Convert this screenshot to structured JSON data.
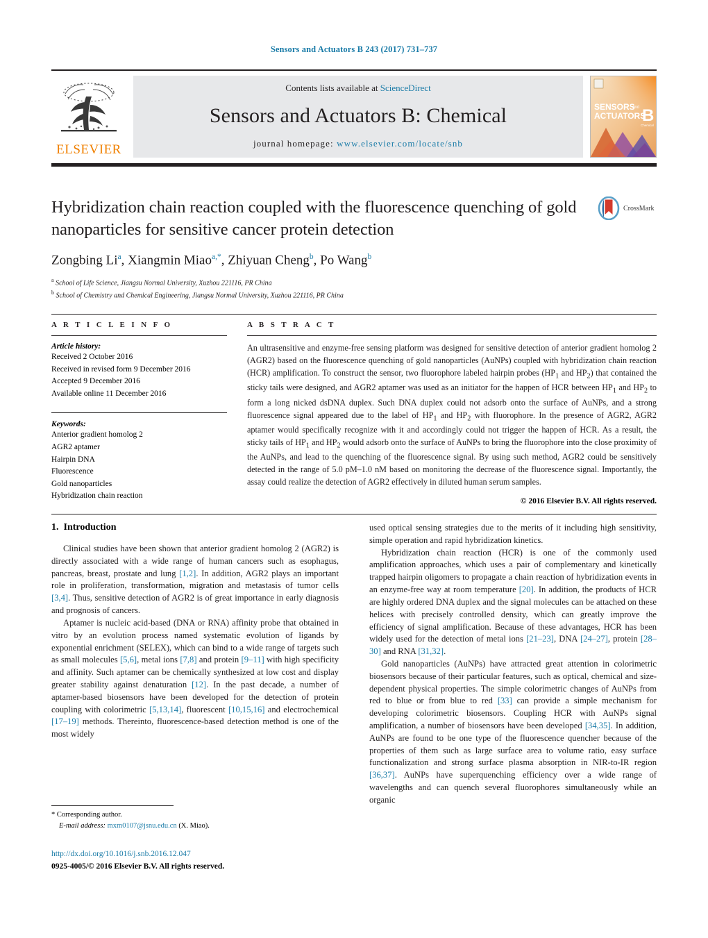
{
  "running_head": "Sensors and Actuators B 243 (2017) 731–737",
  "masthead": {
    "contents_prefix": "Contents lists available at ",
    "sciencedirect": "ScienceDirect",
    "journal_title": "Sensors and Actuators B: Chemical",
    "homepage_prefix": "journal homepage: ",
    "homepage_url": "www.elsevier.com/locate/snb",
    "publisher": "ELSEVIER",
    "cover_line1": "SENSORS",
    "cover_and": "and",
    "cover_line2": "ACTUATORS",
    "cover_letter": "B",
    "cover_sub": "Chemical",
    "accent_orange": "#f08000",
    "band_gray": "#e7e8ea",
    "link_blue": "#1b7ca8"
  },
  "title_block": {
    "title": "Hybridization chain reaction coupled with the fluorescence quenching of gold nanoparticles for sensitive cancer protein detection",
    "crossmark_label": "CrossMark",
    "authors_html": "Zongbing Li<sup>a</sup>, Xiangmin Miao<sup>a,*</sup>, Zhiyuan Cheng<sup>b</sup>, Po Wang<sup>b</sup>",
    "affiliations": [
      {
        "marker": "a",
        "text": "School of Life Science, Jiangsu Normal University, Xuzhou 221116, PR China"
      },
      {
        "marker": "b",
        "text": "School of Chemistry and Chemical Engineering, Jiangsu Normal University, Xuzhou 221116, PR China"
      }
    ]
  },
  "article_info": {
    "heading": "A R T I C L E   I N F O",
    "history_label": "Article history:",
    "history": [
      "Received 2 October 2016",
      "Received in revised form 9 December 2016",
      "Accepted 9 December 2016",
      "Available online 11 December 2016"
    ],
    "keywords_label": "Keywords:",
    "keywords": [
      "Anterior gradient homolog 2",
      "AGR2 aptamer",
      "Hairpin DNA",
      "Fluorescence",
      "Gold nanoparticles",
      "Hybridization chain reaction"
    ]
  },
  "abstract": {
    "heading": "A B S T R A C T",
    "text_html": "An ultrasensitive and enzyme-free sensing platform was designed for sensitive detection of anterior gradient homolog 2 (AGR2) based on the fluorescence quenching of gold nanoparticles (AuNPs) coupled with hybridization chain reaction (HCR) amplification. To construct the sensor, two fluorophore labeled hairpin probes (HP<sub>1</sub> and HP<sub>2</sub>) that contained the sticky tails were designed, and AGR2 aptamer was used as an initiator for the happen of HCR between HP<sub>1</sub> and HP<sub>2</sub> to form a long nicked dsDNA duplex. Such DNA duplex could not adsorb onto the surface of AuNPs, and a strong fluorescence signal appeared due to the label of HP<sub>1</sub> and HP<sub>2</sub> with fluorophore. In the presence of AGR2, AGR2 aptamer would specifically recognize with it and accordingly could not trigger the happen of HCR. As a result, the sticky tails of HP<sub>1</sub> and HP<sub>2</sub> would adsorb onto the surface of AuNPs to bring the fluorophore into the close proximity of the AuNPs, and lead to the quenching of the fluorescence signal. By using such method, AGR2 could be sensitively detected in the range of 5.0 pM–1.0 nM based on monitoring the decrease of the fluorescence signal. Importantly, the assay could realize the detection of AGR2 effectively in diluted human serum samples.",
    "copyright": "© 2016 Elsevier B.V. All rights reserved."
  },
  "body": {
    "section_number": "1.",
    "section_title": "Introduction",
    "left_paragraphs_html": [
      "Clinical studies have been shown that anterior gradient homolog 2 (AGR2) is directly associated with a wide range of human cancers such as esophagus, pancreas, breast, prostate and lung <span class=\"link\">[1,2]</span>. In addition, AGR2 plays an important role in proliferation, transformation, migration and metastasis of tumor cells <span class=\"link\">[3,4]</span>. Thus, sensitive detection of AGR2 is of great importance in early diagnosis and prognosis of cancers.",
      "Aptamer is nucleic acid-based (DNA or RNA) affinity probe that obtained in vitro by an evolution process named systematic evolution of ligands by exponential enrichment (SELEX), which can bind to a wide range of targets such as small molecules <span class=\"link\">[5,6]</span>, metal ions <span class=\"link\">[7,8]</span> and protein <span class=\"link\">[9–11]</span> with high specificity and affinity. Such aptamer can be chemically synthesized at low cost and display greater stability against denaturation <span class=\"link\">[12]</span>. In the past decade, a number of aptamer-based biosensors have been developed for the detection of protein coupling with colorimetric <span class=\"link\">[5,13,14]</span>, fluorescent <span class=\"link\">[10,15,16]</span> and electrochemical <span class=\"link\">[17–19]</span> methods. Thereinto, fluorescence-based detection method is one of the most widely"
    ],
    "right_paragraphs_html": [
      "used optical sensing strategies due to the merits of it including high sensitivity, simple operation and rapid hybridization kinetics.",
      "Hybridization chain reaction (HCR) is one of the commonly used amplification approaches, which uses a pair of complementary and kinetically trapped hairpin oligomers to propagate a chain reaction of hybridization events in an enzyme-free way at room temperature <span class=\"link\">[20]</span>. In addition, the products of HCR are highly ordered DNA duplex and the signal molecules can be attached on these helices with precisely controlled density, which can greatly improve the efficiency of signal amplification. Because of these advantages, HCR has been widely used for the detection of metal ions <span class=\"link\">[21–23]</span>, DNA <span class=\"link\">[24–27]</span>, protein <span class=\"link\">[28–30]</span> and RNA <span class=\"link\">[31,32]</span>.",
      "Gold nanoparticles (AuNPs) have attracted great attention in colorimetric biosensors because of their particular features, such as optical, chemical and size-dependent physical properties. The simple colorimetric changes of AuNPs from red to blue or from blue to red <span class=\"link\">[33]</span> can provide a simple mechanism for developing colorimetric biosensors. Coupling HCR with AuNPs signal amplification, a number of biosensors have been developed <span class=\"link\">[34,35]</span>. In addition, AuNPs are found to be one type of the fluorescence quencher because of the properties of them such as large surface area to volume ratio, easy surface functionalization and strong surface plasma absorption in NIR-to-IR region <span class=\"link\">[36,37]</span>. AuNPs have superquenching efficiency over a wide range of wavelengths and can quench several fluorophores simultaneously while an organic"
    ]
  },
  "footer": {
    "corresponding_marker": "*",
    "corresponding_text": "Corresponding author.",
    "email_label": "E-mail address:",
    "email": "mxm0107@jsnu.edu.cn",
    "email_owner": "(X. Miao).",
    "doi": "http://dx.doi.org/10.1016/j.snb.2016.12.047",
    "issn_line": "0925-4005/© 2016 Elsevier B.V. All rights reserved."
  }
}
